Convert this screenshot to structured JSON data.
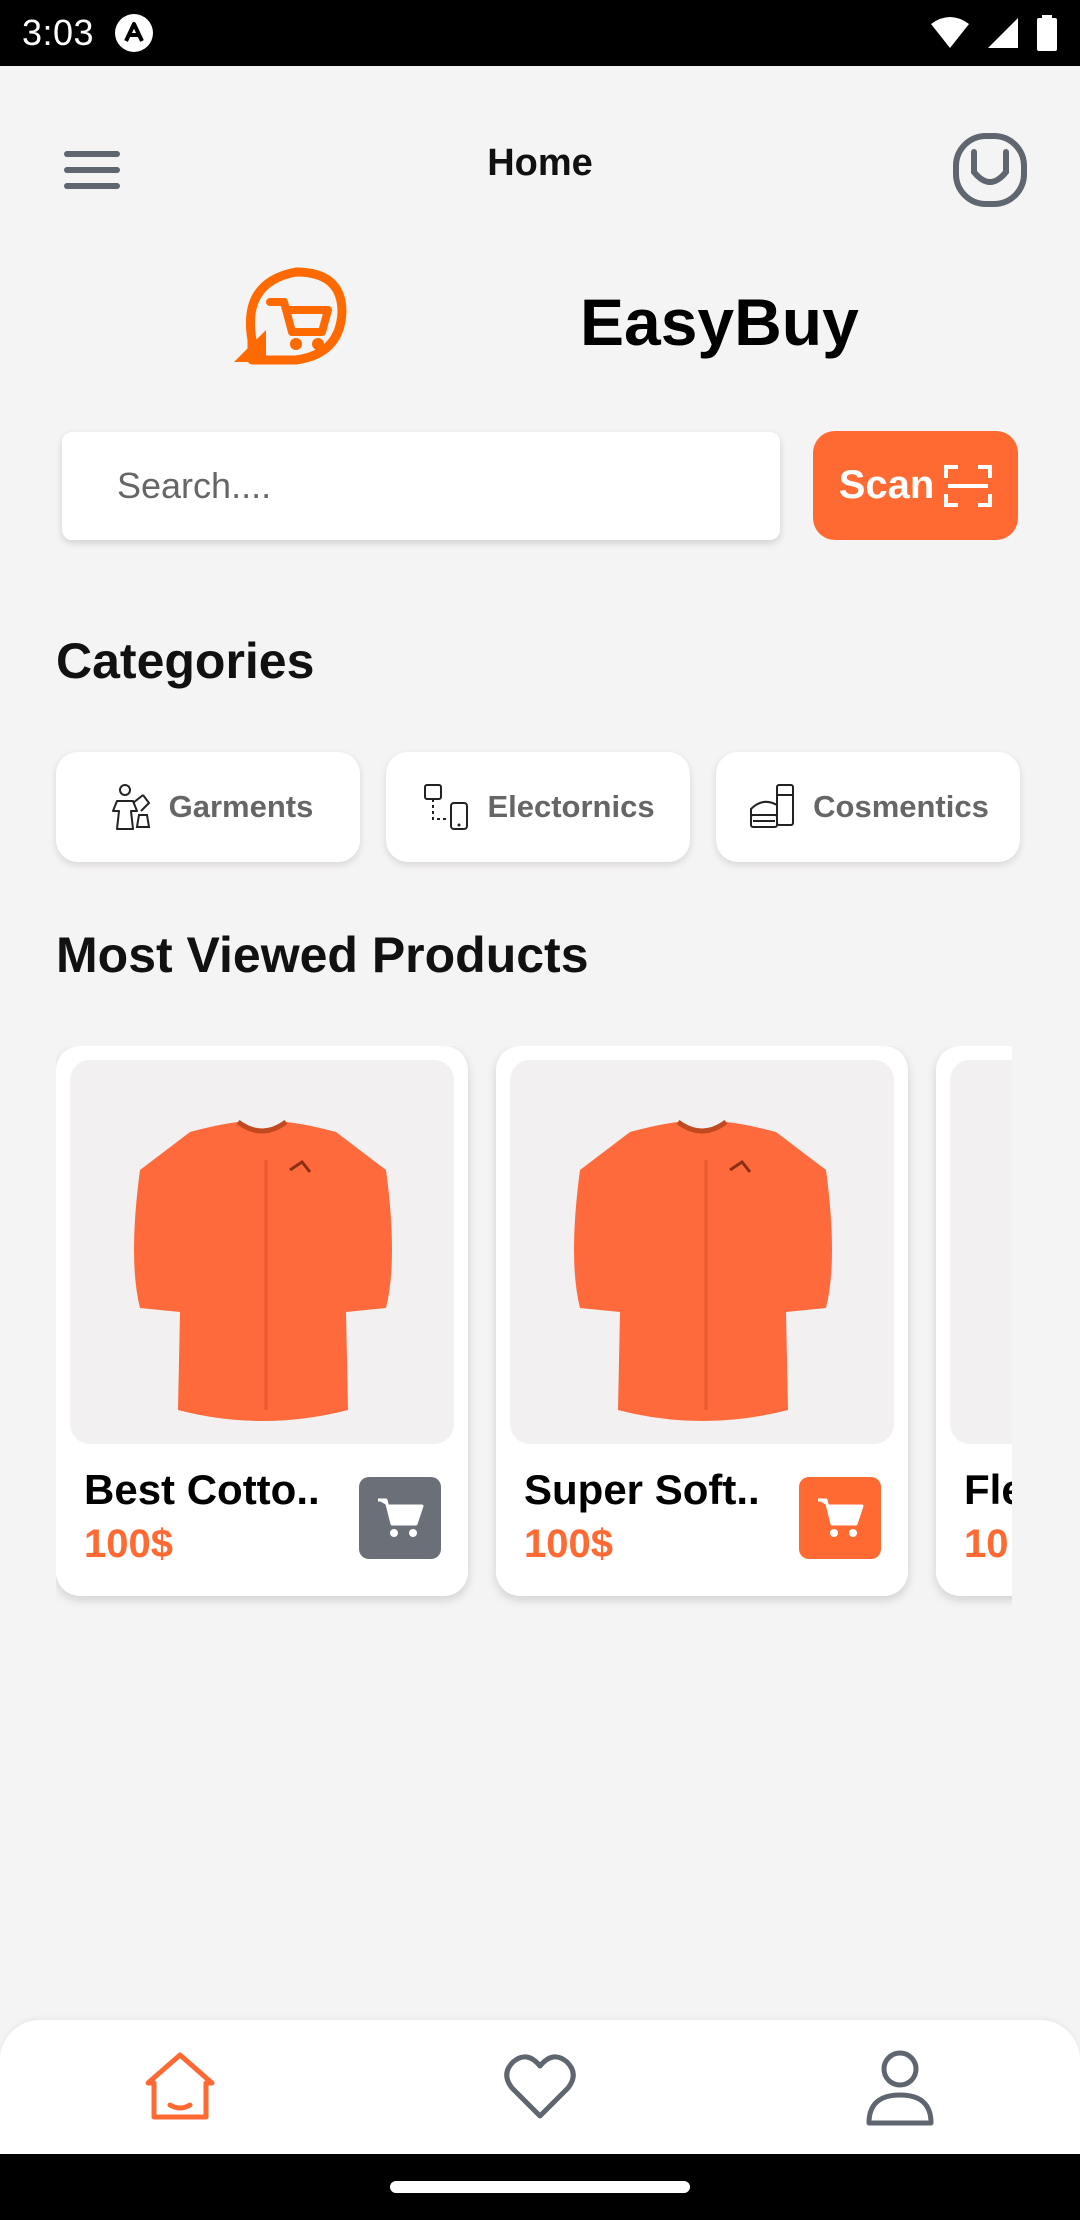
{
  "status_bar": {
    "time": "3:03"
  },
  "header": {
    "title": "Home"
  },
  "brand": {
    "name": "EasyBuy"
  },
  "search": {
    "placeholder": "Search....",
    "scan_label": "Scan"
  },
  "sections": {
    "categories": "Categories",
    "most_viewed": "Most Viewed Products"
  },
  "categories": [
    {
      "label": "Garments",
      "icon": "garments-icon"
    },
    {
      "label": "Electornics",
      "icon": "electronics-icon"
    },
    {
      "label": "Cosmentics",
      "icon": "cosmetics-icon"
    }
  ],
  "products": [
    {
      "name": "Best Cotto..",
      "price": "100$",
      "cart_color": "#6b7078"
    },
    {
      "name": "Super Soft..",
      "price": "100$",
      "cart_color": "#ff6a33"
    },
    {
      "name": "Fle",
      "price": "10",
      "cart_color": "#ff6a33"
    }
  ],
  "bottom_nav": [
    {
      "name": "home",
      "icon": "home-icon",
      "active": true
    },
    {
      "name": "favorites",
      "icon": "heart-icon",
      "active": false
    },
    {
      "name": "profile",
      "icon": "user-icon",
      "active": false
    }
  ],
  "colors": {
    "accent": "#ff6a33",
    "background": "#f5f4f4",
    "muted": "#6b7078"
  }
}
